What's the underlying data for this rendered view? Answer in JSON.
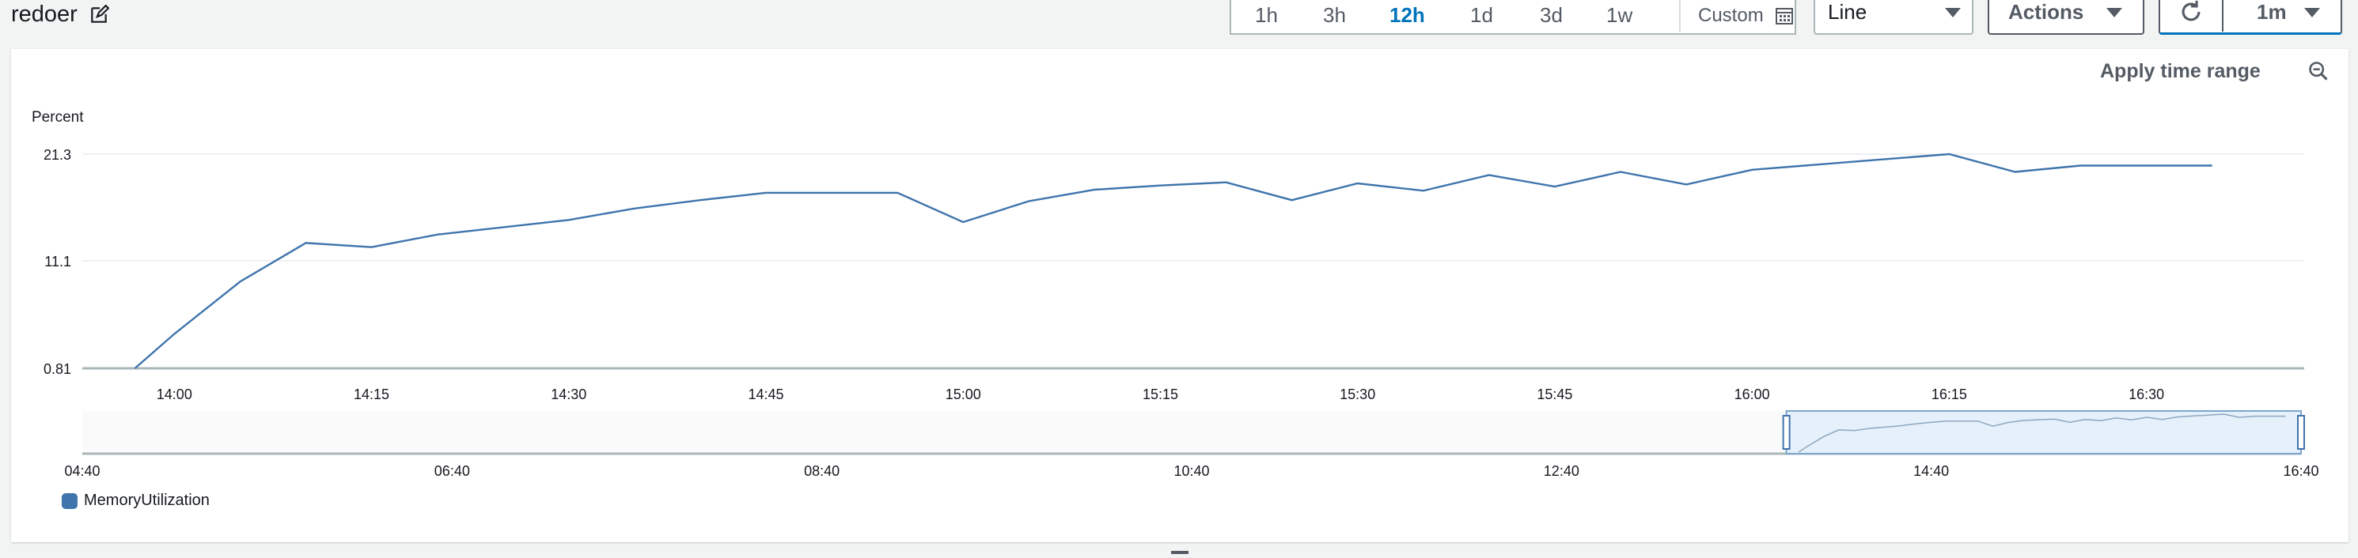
{
  "header": {
    "title": "redoer",
    "time_ranges": [
      "1h",
      "3h",
      "12h",
      "1d",
      "3d",
      "1w"
    ],
    "active_range": "12h",
    "custom_label": "Custom",
    "view_select": "Line",
    "actions_label": "Actions",
    "refresh_interval": "1m"
  },
  "controls": {
    "apply_time_range": "Apply time range"
  },
  "colors": {
    "series": "#3f74ac",
    "active_tab": "#0073bb"
  },
  "chart_data": {
    "type": "line",
    "ylabel": "Percent",
    "ylim": [
      0.81,
      21.3
    ],
    "yticks": [
      "21.3",
      "11.1",
      "0.81"
    ],
    "xticks": [
      "14:00",
      "14:15",
      "14:30",
      "14:45",
      "15:00",
      "15:15",
      "15:30",
      "15:45",
      "16:00",
      "16:15",
      "16:30"
    ],
    "xlim_minutes_range": [
      "13:53",
      "16:42"
    ],
    "series": [
      {
        "name": "MemoryUtilization",
        "x": [
          "13:57",
          "14:00",
          "14:05",
          "14:10",
          "14:15",
          "14:20",
          "14:25",
          "14:30",
          "14:35",
          "14:40",
          "14:45",
          "14:50",
          "14:55",
          "15:00",
          "15:05",
          "15:10",
          "15:15",
          "15:20",
          "15:25",
          "15:30",
          "15:35",
          "15:40",
          "15:45",
          "15:50",
          "15:55",
          "16:00",
          "16:05",
          "16:10",
          "16:15",
          "16:20",
          "16:25",
          "16:30",
          "16:35"
        ],
        "values": [
          0.81,
          4.1,
          9.1,
          12.8,
          12.4,
          13.6,
          14.3,
          15.0,
          16.1,
          16.9,
          17.6,
          17.6,
          17.6,
          14.8,
          16.8,
          17.9,
          18.3,
          18.6,
          16.9,
          18.5,
          17.8,
          19.3,
          18.2,
          19.6,
          18.4,
          19.8,
          20.3,
          20.8,
          21.3,
          19.6,
          20.2,
          20.2,
          20.2
        ]
      }
    ],
    "overview": {
      "xticks": [
        "04:40",
        "06:40",
        "08:40",
        "10:40",
        "12:40",
        "14:40",
        "16:40"
      ],
      "selection": [
        "13:53",
        "16:40"
      ]
    },
    "legend": [
      "MemoryUtilization"
    ],
    "legend_position": "bottom-left",
    "grid": true
  }
}
